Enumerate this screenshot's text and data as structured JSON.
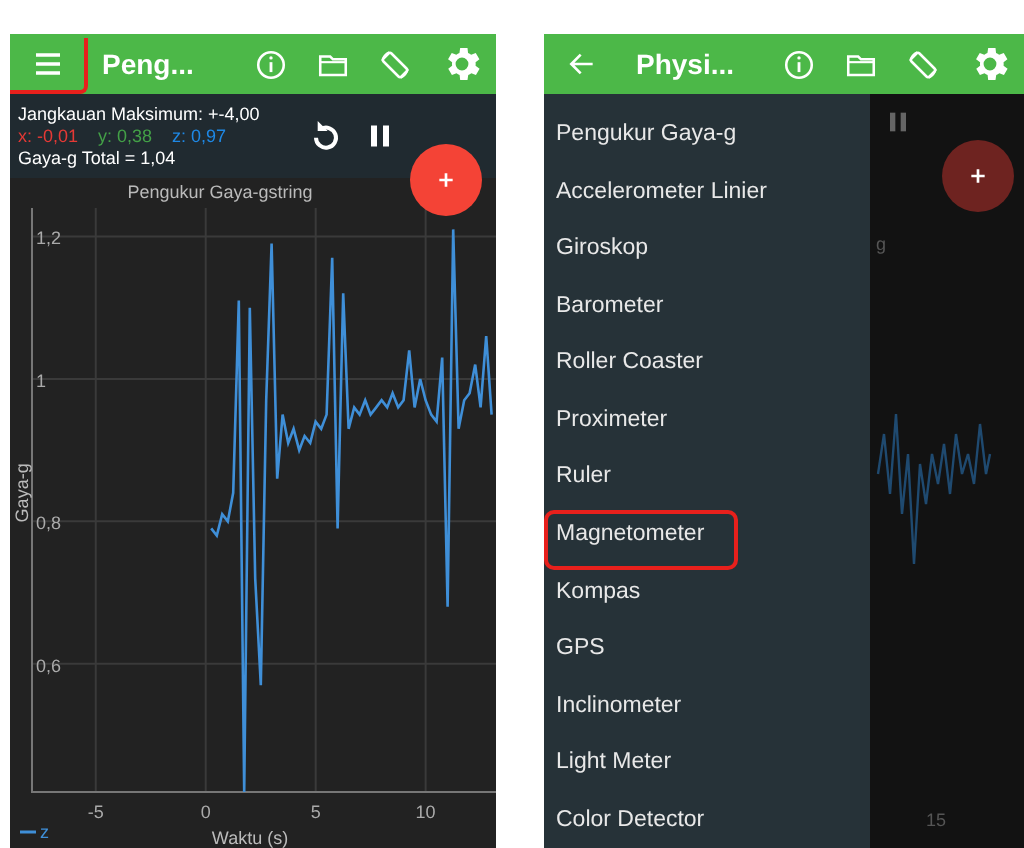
{
  "screens": [
    {
      "kind": "meter",
      "app_bar": {
        "menu_button": {
          "highlighted": true
        },
        "title": "Peng..."
      },
      "readout": {
        "range": "Jangkauan Maksimum: +-4,00",
        "axes": [
          {
            "label": "x: -0,01",
            "color": "#e53935"
          },
          {
            "label": "y: 0,38",
            "color": "#43a047"
          },
          {
            "label": "z: 0,97",
            "color": "#1e88e5"
          }
        ],
        "total": "Gaya-g Total = 1,04"
      },
      "chart_data": {
        "type": "line",
        "title": "Pengukur Gaya-gstring",
        "xlabel": "Waktu (s)",
        "ylabel": "Gaya-g",
        "x": [
          0.25,
          0.5,
          0.75,
          1.0,
          1.25,
          1.5,
          1.75,
          2.0,
          2.25,
          2.5,
          2.75,
          3.0,
          3.25,
          3.5,
          3.75,
          4.0,
          4.25,
          4.5,
          4.75,
          5.0,
          5.25,
          5.5,
          5.75,
          6.0,
          6.25,
          6.5,
          6.75,
          7.0,
          7.25,
          7.5,
          7.75,
          8.0,
          8.25,
          8.5,
          8.75,
          9.0,
          9.25,
          9.5,
          9.75,
          10.0,
          10.25,
          10.5,
          10.75,
          11.0,
          11.25,
          11.5,
          11.75,
          12.0,
          12.25,
          12.5,
          12.75,
          13.0
        ],
        "series": [
          {
            "name": "z",
            "color": "#3f8fd8",
            "values": [
              0.79,
              0.78,
              0.81,
              0.8,
              0.84,
              1.11,
              0.42,
              1.1,
              0.72,
              0.57,
              0.97,
              1.19,
              0.86,
              0.95,
              0.91,
              0.93,
              0.9,
              0.92,
              0.91,
              0.94,
              0.93,
              0.95,
              1.17,
              0.79,
              1.12,
              0.93,
              0.96,
              0.95,
              0.97,
              0.95,
              0.96,
              0.97,
              0.96,
              0.98,
              0.96,
              0.97,
              1.04,
              0.96,
              1.0,
              0.97,
              0.95,
              0.94,
              1.03,
              0.68,
              1.21,
              0.93,
              0.97,
              0.98,
              1.02,
              0.96,
              1.06,
              0.95
            ]
          }
        ],
        "grid": true,
        "xlim": [
          -7.9,
          13.2
        ],
        "ylim": [
          0.42,
          1.24
        ],
        "xticks": [
          -5,
          0,
          5,
          10
        ],
        "yticks": [
          {
            "value": 0.6,
            "label": "0,6"
          },
          {
            "value": 0.8,
            "label": "0,8"
          },
          {
            "value": 1,
            "label": "1"
          },
          {
            "value": 1.2,
            "label": "1,2"
          }
        ]
      }
    },
    {
      "kind": "drawer",
      "app_bar": {
        "title": "Physi..."
      },
      "drawer": {
        "items": [
          {
            "label": "Pengukur Gaya-g",
            "highlighted": false
          },
          {
            "label": "Accelerometer Linier",
            "highlighted": false
          },
          {
            "label": "Giroskop",
            "highlighted": false
          },
          {
            "label": "Barometer",
            "highlighted": false
          },
          {
            "label": "Roller Coaster",
            "highlighted": false
          },
          {
            "label": "Proximeter",
            "highlighted": false
          },
          {
            "label": "Ruler",
            "highlighted": false
          },
          {
            "label": "Magnetometer",
            "highlighted": true
          },
          {
            "label": "Kompas",
            "highlighted": false
          },
          {
            "label": "GPS",
            "highlighted": false
          },
          {
            "label": "Inclinometer",
            "highlighted": false
          },
          {
            "label": "Light Meter",
            "highlighted": false
          },
          {
            "label": "Color Detector",
            "highlighted": false
          }
        ]
      },
      "behind": {
        "title_fragment": "g",
        "x_tick": "15"
      }
    }
  ]
}
